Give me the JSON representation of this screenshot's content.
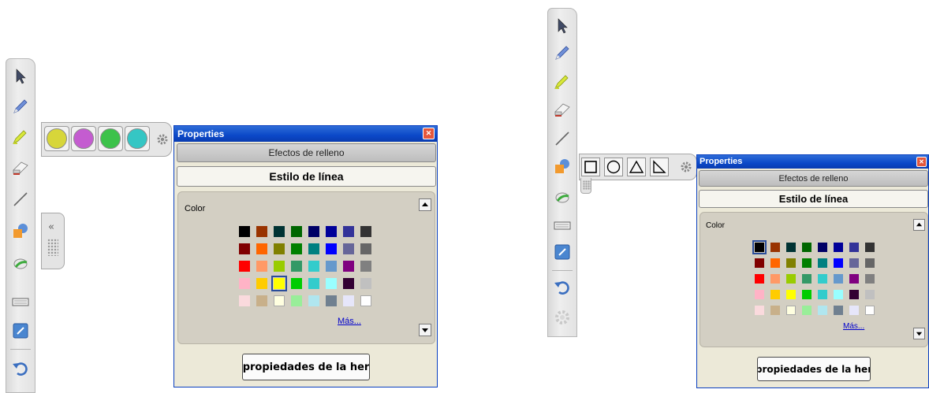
{
  "left": {
    "toolbar_tools": [
      "select-arrow-icon",
      "pen-icon",
      "highlighter-icon",
      "eraser-icon",
      "line-icon",
      "shapes-icon",
      "fill-icon",
      "keyboard-icon",
      "notebook-icon",
      "undo-icon"
    ],
    "fill_colors": [
      "#d7d63a",
      "#c45cd0",
      "#3cc24a",
      "#35c6c4"
    ],
    "properties": {
      "title": "Properties",
      "close_label": "✕",
      "tab_fill_effects": "Efectos de relleno",
      "tab_line_style": "Estilo de línea",
      "color_label": "Color",
      "more_link": "Más...",
      "action_button": "propiedades de la her",
      "selected_color": "#ffff00"
    }
  },
  "right": {
    "toolbar_tools": [
      "select-arrow-icon",
      "pen-icon",
      "highlighter-icon",
      "eraser-icon",
      "line-icon",
      "shapes-icon",
      "fill-icon",
      "keyboard-icon",
      "notebook-icon",
      "undo-icon",
      "settings-icon"
    ],
    "shape_tools": [
      "square-icon",
      "circle-icon",
      "triangle-icon",
      "right-triangle-icon"
    ],
    "properties": {
      "title": "Properties",
      "close_label": "✕",
      "tab_fill_effects": "Efectos de relleno",
      "tab_line_style": "Estilo de línea",
      "color_label": "Color",
      "more_link": "Más...",
      "action_button": "propiedades de la her",
      "selected_color": "#000000"
    }
  },
  "palette": [
    [
      "#000000",
      "#993300",
      "#003333",
      "#006600",
      "#000066",
      "#000099",
      "#333399",
      "#333333"
    ],
    [
      "#800000",
      "#ff6600",
      "#808000",
      "#008000",
      "#008080",
      "#0000ff",
      "#666699",
      "#666666"
    ],
    [
      "#ff0000",
      "#ff9966",
      "#99cc00",
      "#339966",
      "#33cccc",
      "#6699cc",
      "#800080",
      "#808080"
    ],
    [
      "#ffb3c6",
      "#ffcc00",
      "#ffff00",
      "#00cc00",
      "#33cccc",
      "#99ffff",
      "#330033",
      "#c0c0c0"
    ],
    [
      "#fadadd",
      "#c8b08a",
      "#ffffe0",
      "#99ee99",
      "#b0e6ef",
      "#708090",
      "#e6e6fa",
      "#ffffff"
    ]
  ]
}
